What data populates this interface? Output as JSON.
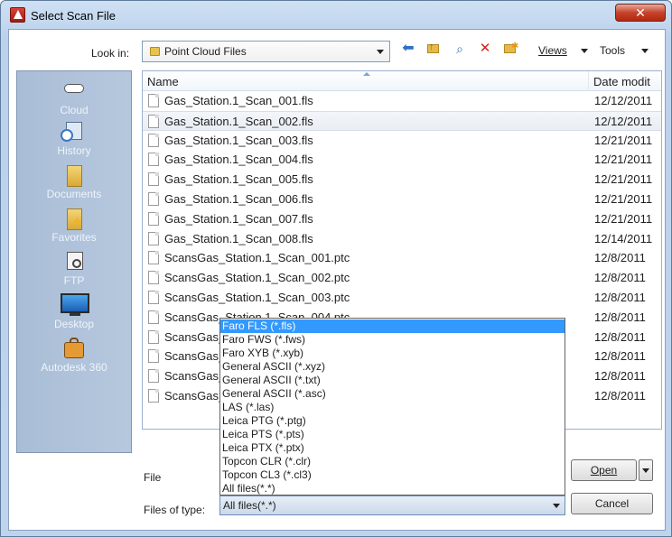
{
  "window": {
    "title": "Select Scan File"
  },
  "toolbar": {
    "look_in_label": "Look in:",
    "look_in_value": "Point Cloud Files",
    "views_label": "Views",
    "tools_label": "Tools"
  },
  "places": [
    {
      "label": "Cloud",
      "icon": "cloud-icon"
    },
    {
      "label": "History",
      "icon": "history-icon"
    },
    {
      "label": "Documents",
      "icon": "documents-folder-icon"
    },
    {
      "label": "Favorites",
      "icon": "favorites-folder-icon"
    },
    {
      "label": "FTP",
      "icon": "ftp-icon"
    },
    {
      "label": "Desktop",
      "icon": "desktop-icon"
    },
    {
      "label": "Autodesk 360",
      "icon": "autodesk-360-icon"
    }
  ],
  "list": {
    "columns": {
      "name": "Name",
      "date": "Date modit"
    },
    "rows": [
      {
        "name": "Gas_Station.1_Scan_001.fls",
        "date": "12/12/2011"
      },
      {
        "name": "Gas_Station.1_Scan_002.fls",
        "date": "12/12/2011"
      },
      {
        "name": "Gas_Station.1_Scan_003.fls",
        "date": "12/21/2011"
      },
      {
        "name": "Gas_Station.1_Scan_004.fls",
        "date": "12/21/2011"
      },
      {
        "name": "Gas_Station.1_Scan_005.fls",
        "date": "12/21/2011"
      },
      {
        "name": "Gas_Station.1_Scan_006.fls",
        "date": "12/21/2011"
      },
      {
        "name": "Gas_Station.1_Scan_007.fls",
        "date": "12/21/2011"
      },
      {
        "name": "Gas_Station.1_Scan_008.fls",
        "date": "12/14/2011"
      },
      {
        "name": "ScansGas_Station.1_Scan_001.ptc",
        "date": "12/8/2011"
      },
      {
        "name": "ScansGas_Station.1_Scan_002.ptc",
        "date": "12/8/2011"
      },
      {
        "name": "ScansGas_Station.1_Scan_003.ptc",
        "date": "12/8/2011"
      },
      {
        "name": "ScansGas_Station.1_Scan_004.ptc",
        "date": "12/8/2011"
      },
      {
        "name": "ScansGas_",
        "date": "12/8/2011"
      },
      {
        "name": "ScansGas_",
        "date": "12/8/2011"
      },
      {
        "name": "ScansGas_",
        "date": "12/8/2011"
      },
      {
        "name": "ScansGas_",
        "date": "12/8/2011"
      }
    ],
    "selected_index": 1
  },
  "form": {
    "file_label": "File",
    "type_label": "Files of type:",
    "type_value": "All files(*.*)"
  },
  "buttons": {
    "open": "Open",
    "cancel": "Cancel"
  },
  "type_options": [
    "Faro FLS (*.fls)",
    "Faro FWS (*.fws)",
    "Faro XYB (*.xyb)",
    "General ASCII (*.xyz)",
    "General ASCII (*.txt)",
    "General ASCII (*.asc)",
    "LAS (*.las)",
    "Leica PTG (*.ptg)",
    "Leica PTS (*.pts)",
    "Leica PTX (*.ptx)",
    "Topcon CLR (*.clr)",
    "Topcon CL3 (*.cl3)",
    "All files(*.*)"
  ],
  "highlighted_option_index": 0
}
